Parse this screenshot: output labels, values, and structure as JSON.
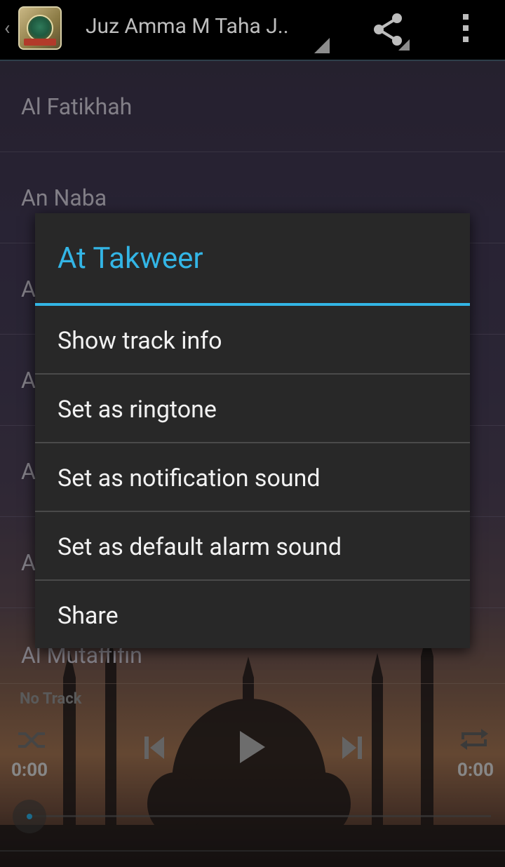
{
  "actionbar": {
    "title": "Juz Amma M Taha J..",
    "up_glyph": "‹",
    "icons": [
      "app-icon",
      "share-icon",
      "overflow-menu-icon"
    ]
  },
  "track_list": [
    {
      "title": "Al Fatikhah"
    },
    {
      "title": "An Naba"
    },
    {
      "title": "A"
    },
    {
      "title": "A"
    },
    {
      "title": "A"
    },
    {
      "title": "A"
    },
    {
      "title": "Al Mutaffifin"
    }
  ],
  "player": {
    "now_playing": "No Track",
    "time_elapsed": "0:00",
    "time_total": "0:00",
    "progress": 0,
    "icons": [
      "shuffle-icon",
      "previous-icon",
      "play-icon",
      "next-icon",
      "repeat-icon"
    ]
  },
  "dialog": {
    "title": "At Takweer",
    "items": [
      {
        "label": "Show track info"
      },
      {
        "label": "Set as ringtone"
      },
      {
        "label": "Set as notification sound"
      },
      {
        "label": "Set as default alarm sound"
      },
      {
        "label": "Share"
      }
    ]
  },
  "colors": {
    "accent": "#33b5e5",
    "dialog_bg": "#282828",
    "actionbar_bg": "#000000"
  }
}
